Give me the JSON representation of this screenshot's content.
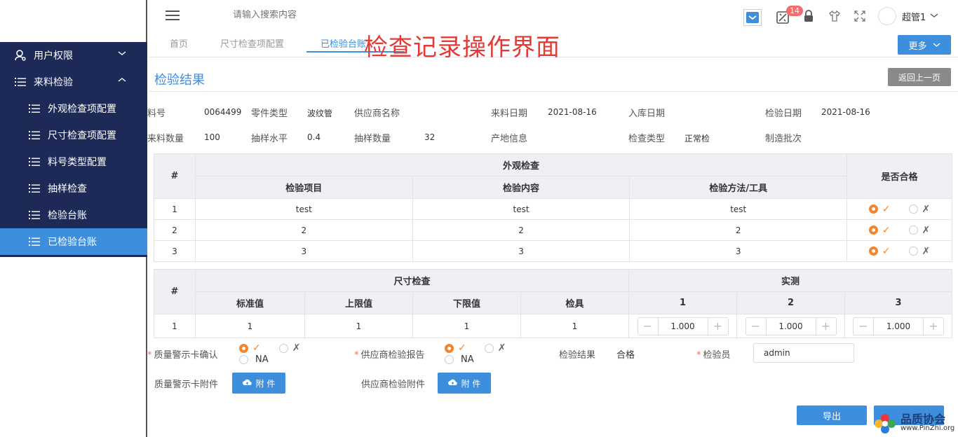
{
  "sidebar": {
    "items": [
      {
        "label": "用户权限",
        "icon": "user-icon",
        "arrow": "˅"
      },
      {
        "label": "来料检验",
        "icon": "list-icon",
        "arrow": "˄"
      },
      {
        "label": "外观检查项配置",
        "icon": "list-icon"
      },
      {
        "label": "尺寸检查项配置",
        "icon": "list-icon"
      },
      {
        "label": "料号类型配置",
        "icon": "list-icon"
      },
      {
        "label": "抽样检查",
        "icon": "list-icon"
      },
      {
        "label": "检验台账",
        "icon": "list-icon"
      },
      {
        "label": "已检验台账",
        "icon": "list-icon"
      }
    ]
  },
  "topbar": {
    "search_placeholder": "请输入搜索内容",
    "badge": "14",
    "user_name": "超管1"
  },
  "tabs": {
    "items": [
      "首页",
      "尺寸检查项配置",
      "已检验台账"
    ],
    "more": "更多"
  },
  "overlay_title": "检查记录操作界面",
  "page": {
    "title": "检验结果",
    "back": "返回上一页"
  },
  "info": {
    "part_no_label": "料号",
    "part_no": "0064499",
    "part_type_label": "零件类型",
    "part_type": "波纹管",
    "supplier_label": "供应商名称",
    "supplier": "",
    "incoming_date_label": "来料日期",
    "incoming_date": "2021-08-16",
    "stock_date_label": "入库日期",
    "stock_date": "",
    "inspect_date_label": "检验日期",
    "inspect_date": "2021-08-16",
    "qty_label": "来料数量",
    "qty": "100",
    "sample_level_label": "抽样水平",
    "sample_level": "0.4",
    "sample_qty_label": "抽样数量",
    "sample_qty": "32",
    "origin_label": "产地信息",
    "origin": "",
    "inspect_type_label": "检查类型",
    "inspect_type": "正常检",
    "batch_label": "制造批次",
    "batch": ""
  },
  "appearance": {
    "hash": "#",
    "group": "外观检查",
    "col_item": "检验项目",
    "col_content": "检验内容",
    "col_method": "检验方法/工具",
    "col_pass": "是否合格",
    "rows": [
      {
        "no": "1",
        "item": "test",
        "content": "test",
        "method": "test",
        "pass": true
      },
      {
        "no": "2",
        "item": "2",
        "content": "2",
        "method": "2",
        "pass": true
      },
      {
        "no": "3",
        "item": "3",
        "content": "3",
        "method": "3",
        "pass": true
      }
    ]
  },
  "dimension": {
    "hash": "#",
    "group": "尺寸检查",
    "measured": "实测",
    "col_std": "标准值",
    "col_upper": "上限值",
    "col_lower": "下限值",
    "col_gauge": "检具",
    "m1": "1",
    "m2": "2",
    "m3": "3",
    "rows": [
      {
        "no": "1",
        "std": "1",
        "upper": "1",
        "lower": "1",
        "gauge": "1",
        "v1": "1.000",
        "v2": "1.000",
        "v3": "1.000"
      }
    ]
  },
  "form": {
    "warn_card_label": "质量警示卡确认",
    "supplier_report_label": "供应商检验报告",
    "na": "NA",
    "result_label": "检验结果",
    "result": "合格",
    "inspector_label": "检验员",
    "inspector": "admin",
    "warn_attach_label": "质量警示卡附件",
    "supplier_attach_label": "供应商检验附件",
    "attach_btn": "附 件",
    "export": "导出"
  },
  "watermark": {
    "title": "品质协会",
    "url": "www.PinZhi.org"
  },
  "colors": {
    "sidebar_bg": "#1d2a57",
    "accent": "#3e8ede",
    "radio_on": "#f5852b",
    "overlay": "#e53935"
  }
}
